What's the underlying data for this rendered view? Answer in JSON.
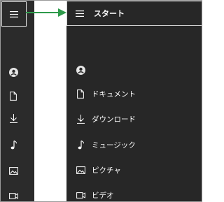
{
  "rail": {
    "menu_icon": "hamburger-icon",
    "icons": [
      "account-icon",
      "document-icon",
      "download-icon",
      "music-icon",
      "image-icon",
      "video-icon"
    ]
  },
  "pane": {
    "title": "スタート",
    "menu_icon": "hamburger-icon",
    "account_icon": "account-icon",
    "items": [
      {
        "icon": "document-icon",
        "label": "ドキュメント"
      },
      {
        "icon": "download-icon",
        "label": "ダウンロード"
      },
      {
        "icon": "music-icon",
        "label": "ミュージック"
      },
      {
        "icon": "image-icon",
        "label": "ピクチャ"
      },
      {
        "icon": "video-icon",
        "label": "ビデオ"
      }
    ]
  },
  "colors": {
    "pane_bg": "#272727",
    "rail_bg": "#2b2b2b",
    "arrow": "#2e9a4a",
    "text": "#ffffff"
  }
}
